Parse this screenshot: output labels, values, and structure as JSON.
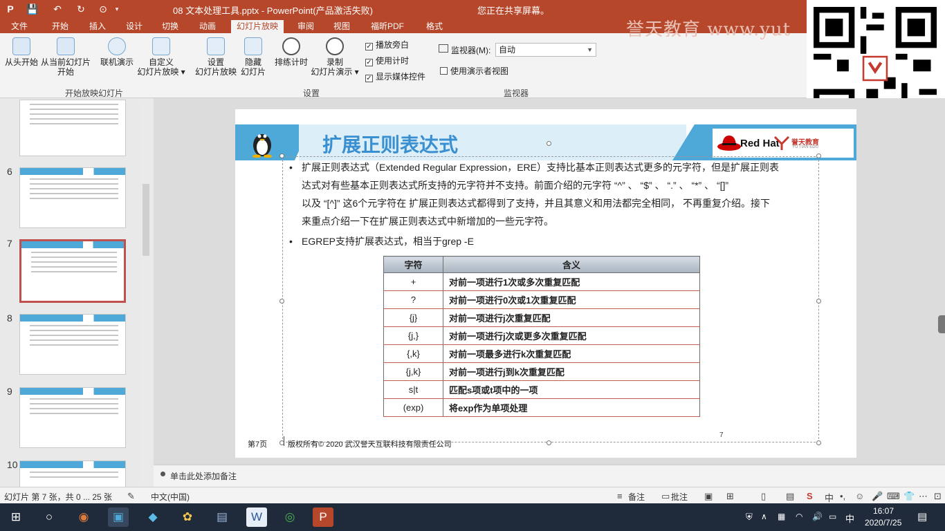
{
  "window": {
    "title": "08 文本处理工具.pptx - PowerPoint(产品激活失败)",
    "share_notice": "您正在共享屏幕。"
  },
  "ribbon_tabs": [
    "文件",
    "开始",
    "插入",
    "设计",
    "切换",
    "动画",
    "幻灯片放映",
    "审阅",
    "视图",
    "福昕PDF",
    "格式"
  ],
  "ribbon": {
    "buttons": {
      "from_start": "从头开始",
      "from_current_1": "从当前幻灯片",
      "from_current_2": "开始",
      "online": "联机演示",
      "custom_1": "自定义",
      "custom_2": "幻灯片放映",
      "setup_1": "设置",
      "setup_2": "幻灯片放映",
      "hide_1": "隐藏",
      "hide_2": "幻灯片",
      "rehearse": "排练计时",
      "record_1": "录制",
      "record_2": "幻灯片演示"
    },
    "checkboxes": {
      "narration": "播放旁白",
      "timing": "使用计时",
      "media": "显示媒体控件",
      "presenter": "使用演示者视图"
    },
    "monitor_label": "监视器(M):",
    "monitor_value": "自动",
    "groups": {
      "start": "开始放映幻灯片",
      "setup": "设置",
      "monitors": "监视器"
    }
  },
  "brand_overlay": "誉天教育 www.yut",
  "thumbnails": [
    {
      "number": "",
      "selected": false
    },
    {
      "number": "6",
      "selected": false
    },
    {
      "number": "7",
      "selected": true
    },
    {
      "number": "8",
      "selected": false
    },
    {
      "number": "9",
      "selected": false
    },
    {
      "number": "10",
      "selected": false
    }
  ],
  "slide": {
    "title": "扩展正则表达式",
    "redhat": "Red Hat",
    "yt_name": "誉天教育",
    "yt_sub": "YU TIAN EDU",
    "bullet1_line1": "扩展正则表达式（Extended Regular Expression，ERE）支持比基本正则表达式更多的元字符，但是扩展正则表",
    "bullet1_line2": "达式对有些基本正则表达式所支持的元字符并不支持。前面介绍的元字符 “^” 、 “$” 、 “.” 、 “*” 、 “[]”",
    "bullet1_line3": "以及 “[^]” 这6个元字符在 扩展正则表达式都得到了支持，并且其意义和用法都完全相同， 不再重复介绍。接下",
    "bullet1_line4": "来重点介绍一下在扩展正则表达式中新增加的一些元字符。",
    "bullet2": "EGREP支持扩展表达式，相当于grep  -E",
    "table_headers": [
      "字符",
      "含义"
    ],
    "table_rows": [
      [
        "+",
        "对前一项进行1次或多次重复匹配"
      ],
      [
        "?",
        "对前一项进行0次或1次重复匹配"
      ],
      [
        "{j}",
        "对前一项进行j次重复匹配"
      ],
      [
        "{j,}",
        "对前一项进行j次或更多次重复匹配"
      ],
      [
        "{,k}",
        "对前一项最多进行k次重复匹配"
      ],
      [
        "{j,k}",
        "对前一项进行j到k次重复匹配"
      ],
      [
        "s|t",
        "匹配s项或t项中的一项"
      ],
      [
        "(exp)",
        "将exp作为单项处理"
      ]
    ],
    "footer_page": "第7页",
    "footer_copyright": "版权所有© 2020 武汉誉天互联科技有限责任公司",
    "page_number": "7"
  },
  "notes_placeholder": "单击此处添加备注",
  "status_bar": {
    "slide_info": "幻灯片 第 7 张，共 0 ... 25 张",
    "language": "中文(中国)",
    "notes": "备注",
    "comments": "批注"
  },
  "taskbar": {
    "ime": "中",
    "time": "16:07",
    "date": "2020/7/25"
  },
  "colors": {
    "accent": "#b7472a",
    "banner_blue": "#4ea8d8",
    "title_blue": "#3a8fd0",
    "table_rule": "#c55a51"
  }
}
